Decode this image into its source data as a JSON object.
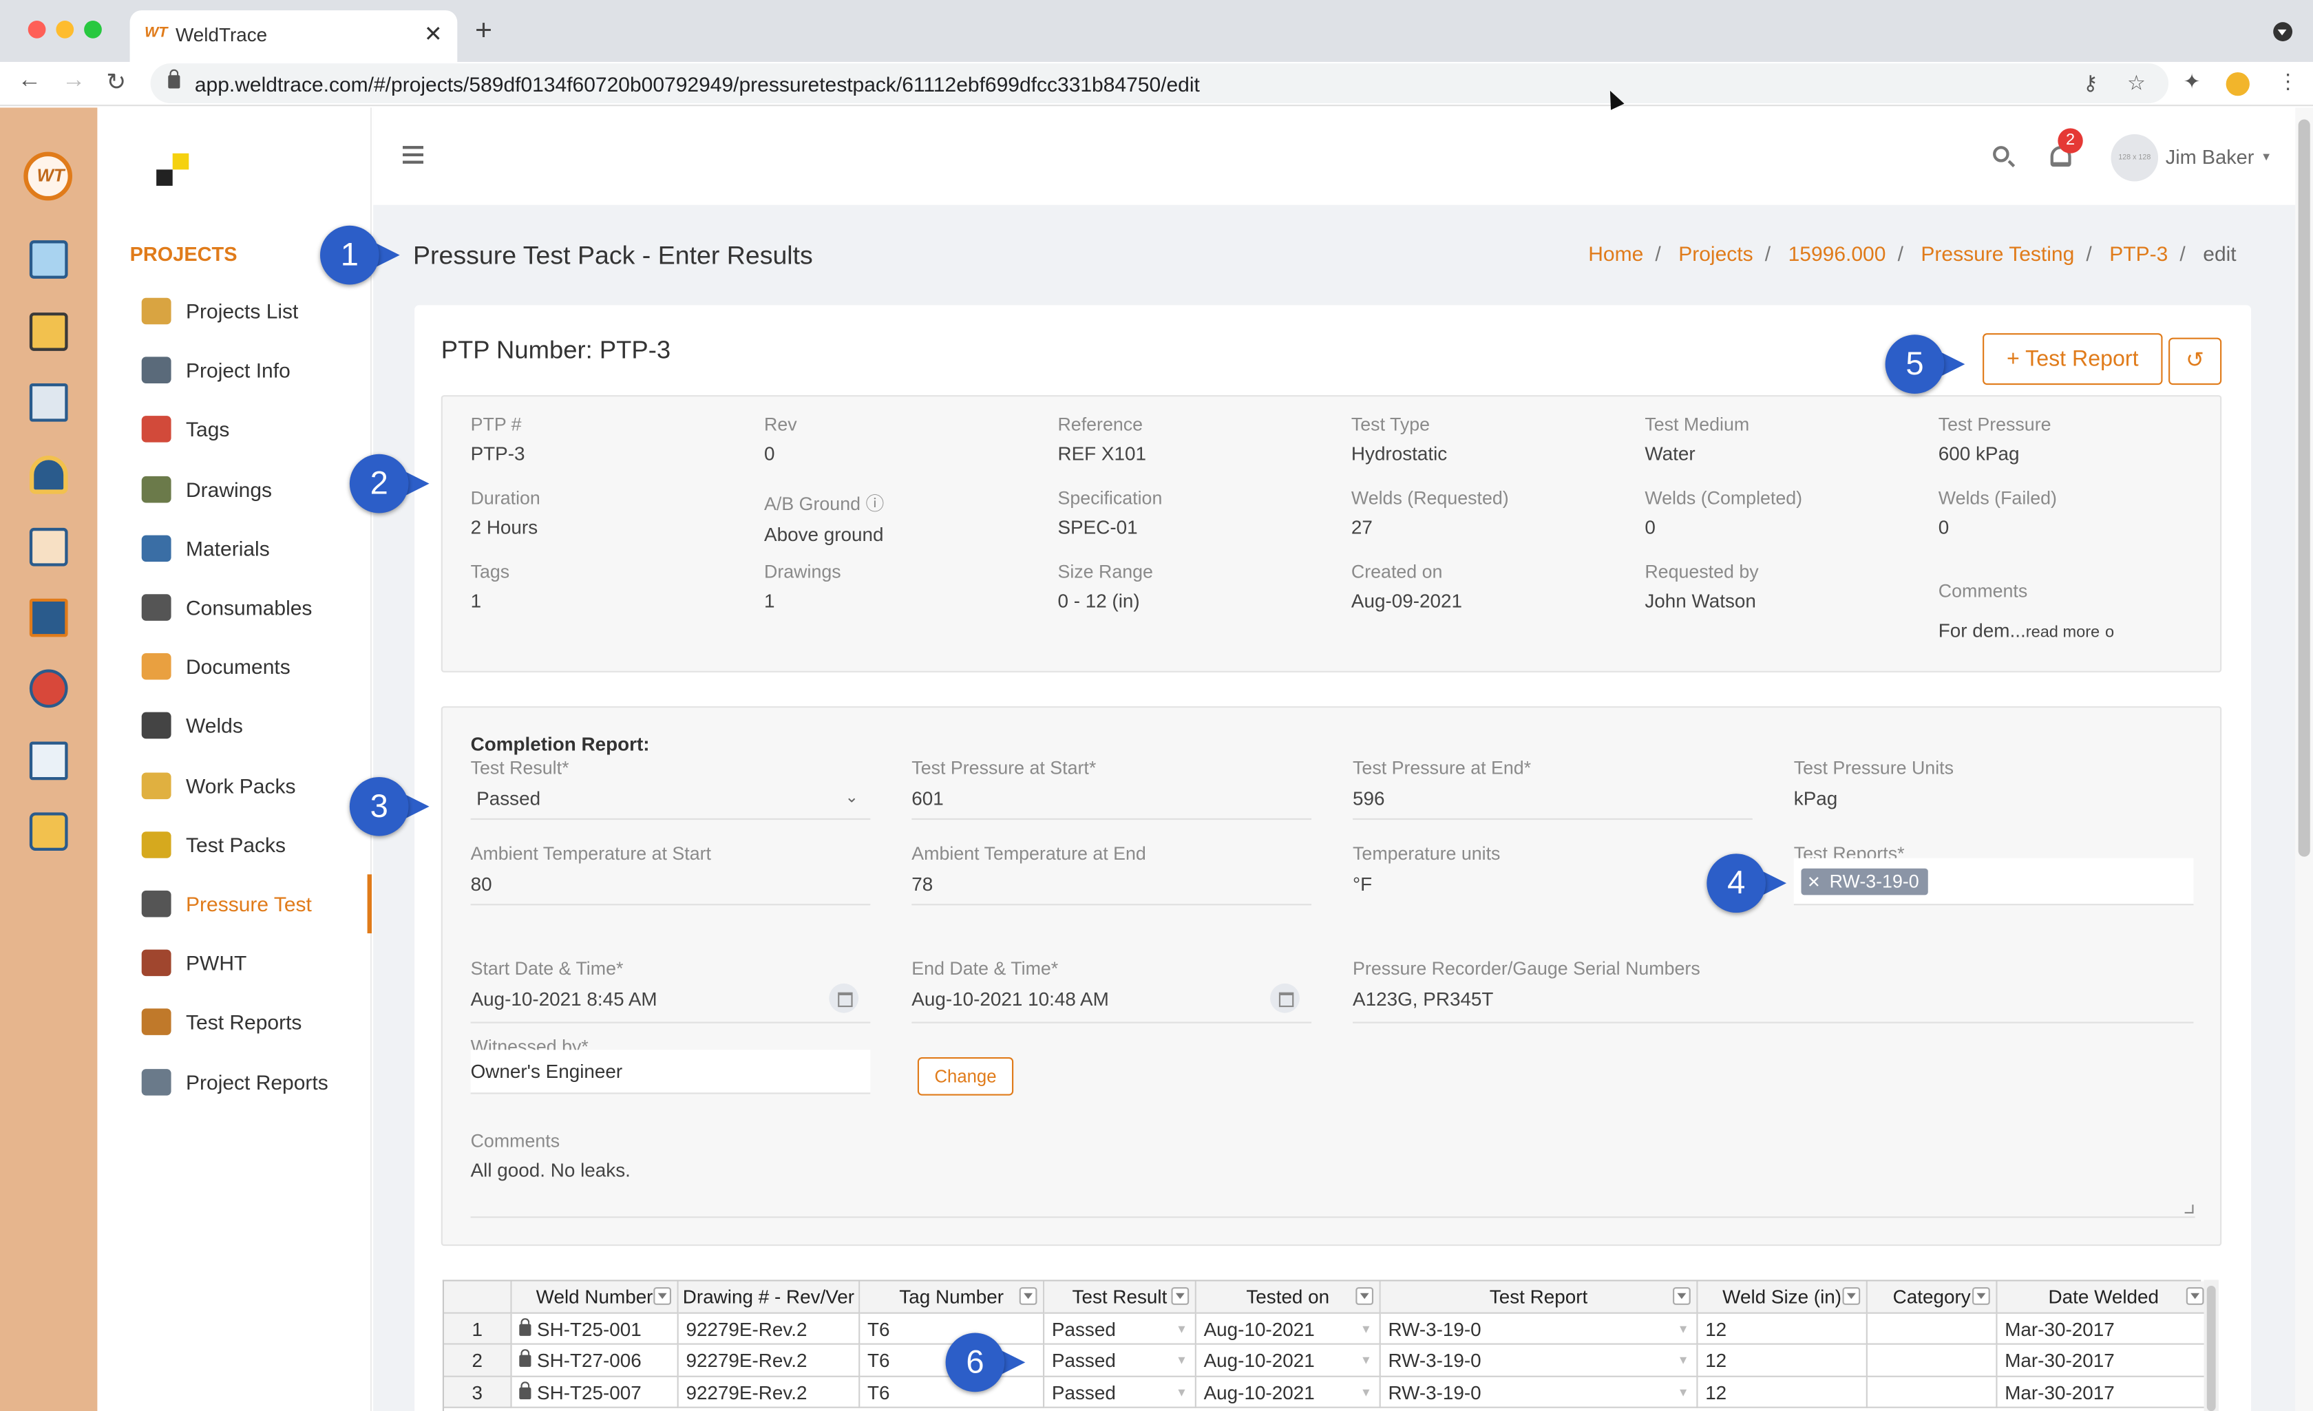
{
  "browser": {
    "tab_title": "WeldTrace",
    "tab_favicon": "WT",
    "url": "app.weldtrace.com/#/projects/589df0134f60720b00792949/pressuretestpack/61112ebf699dfcc331b84750/edit"
  },
  "rail": {
    "logo": "WT",
    "icons": [
      "monitor-icon",
      "folder-settings-icon",
      "clipboard-icon",
      "welder-icon",
      "org-chart-icon",
      "board-icon",
      "team-icon",
      "report-icon",
      "gauge-icon"
    ]
  },
  "sidebar": {
    "heading": "PROJECTS",
    "items": [
      {
        "label": "Projects List",
        "icon": "folder-icon",
        "color": "#d9a441"
      },
      {
        "label": "Project Info",
        "icon": "gears-icon",
        "color": "#5a6a7a"
      },
      {
        "label": "Tags",
        "icon": "tag-icon",
        "color": "#d24a3a"
      },
      {
        "label": "Drawings",
        "icon": "drawing-icon",
        "color": "#6b7a4a"
      },
      {
        "label": "Materials",
        "icon": "materials-icon",
        "color": "#3a6ea5"
      },
      {
        "label": "Consumables",
        "icon": "spool-icon",
        "color": "#555555"
      },
      {
        "label": "Documents",
        "icon": "documents-icon",
        "color": "#e9a040"
      },
      {
        "label": "Welds",
        "icon": "weld-spark-icon",
        "color": "#444444"
      },
      {
        "label": "Work Packs",
        "icon": "work-pack-icon",
        "color": "#e0b040"
      },
      {
        "label": "Test Packs",
        "icon": "radiation-icon",
        "color": "#d6a91e"
      },
      {
        "label": "Pressure Test",
        "icon": "pressure-gauge-icon",
        "color": "#555555",
        "active": true
      },
      {
        "label": "PWHT",
        "icon": "pwht-coil-icon",
        "color": "#a0462e"
      },
      {
        "label": "Test Reports",
        "icon": "test-report-icon",
        "color": "#c0792a"
      },
      {
        "label": "Project Reports",
        "icon": "project-report-icon",
        "color": "#6a7a8a"
      }
    ]
  },
  "topbar": {
    "notifications": "2",
    "avatar_text": "128 x 128",
    "user_name": "Jim Baker"
  },
  "page": {
    "title": "Pressure Test Pack - Enter Results",
    "breadcrumbs": [
      "Home",
      "Projects",
      "15996.000",
      "Pressure Testing",
      "PTP-3"
    ],
    "breadcrumb_last": "edit"
  },
  "card": {
    "ptp_number": "PTP Number: PTP-3",
    "test_report_button": "Test Report",
    "history_icon": "history-icon"
  },
  "info": {
    "ptp": {
      "label": "PTP #",
      "value": "PTP-3"
    },
    "rev": {
      "label": "Rev",
      "value": "0"
    },
    "reference": {
      "label": "Reference",
      "value": "REF X101"
    },
    "test_type": {
      "label": "Test Type",
      "value": "Hydrostatic"
    },
    "test_medium": {
      "label": "Test Medium",
      "value": "Water"
    },
    "test_pressure": {
      "label": "Test Pressure",
      "value": "600 kPag"
    },
    "duration": {
      "label": "Duration",
      "value": "2 Hours"
    },
    "ab_ground": {
      "label": "A/B Ground",
      "value": "Above ground"
    },
    "specification": {
      "label": "Specification",
      "value": "SPEC-01"
    },
    "welds_requested": {
      "label": "Welds (Requested)",
      "value": "27"
    },
    "welds_completed": {
      "label": "Welds (Completed)",
      "value": "0"
    },
    "welds_failed": {
      "label": "Welds (Failed)",
      "value": "0"
    },
    "tags": {
      "label": "Tags",
      "value": "1"
    },
    "drawings": {
      "label": "Drawings",
      "value": "1"
    },
    "size_range": {
      "label": "Size Range",
      "value": "0 - 12 (in)"
    },
    "created_on": {
      "label": "Created on",
      "value": "Aug-09-2021"
    },
    "requested_by": {
      "label": "Requested by",
      "value": "John Watson"
    },
    "comments": {
      "label": "Comments",
      "value": "For dem...",
      "read_more": "read more"
    }
  },
  "completion": {
    "title": "Completion Report:",
    "test_result": {
      "label": "Test Result*",
      "value": "Passed"
    },
    "pressure_start": {
      "label": "Test Pressure at Start*",
      "value": "601"
    },
    "pressure_end": {
      "label": "Test Pressure at End*",
      "value": "596"
    },
    "pressure_units": {
      "label": "Test Pressure Units",
      "value": "kPag"
    },
    "ambient_start": {
      "label": "Ambient Temperature at Start",
      "value": "80"
    },
    "ambient_end": {
      "label": "Ambient Temperature at End",
      "value": "78"
    },
    "temp_units": {
      "label": "Temperature units",
      "value": "°F"
    },
    "test_reports": {
      "label": "Test Reports*",
      "chip": "RW-3-19-0"
    },
    "start_dt": {
      "label": "Start Date & Time*",
      "value": "Aug-10-2021 8:45 AM"
    },
    "end_dt": {
      "label": "End Date & Time*",
      "value": "Aug-10-2021 10:48 AM"
    },
    "gauge_serials": {
      "label": "Pressure Recorder/Gauge Serial Numbers",
      "value": "A123G, PR345T"
    },
    "witnessed": {
      "label": "Witnessed by*",
      "value": "Owner's Engineer"
    },
    "change_button": "Change",
    "comments": {
      "label": "Comments",
      "value": "All good. No leaks."
    }
  },
  "grid": {
    "columns": [
      "",
      "Weld Number",
      "Drawing # - Rev/Ver",
      "Tag Number",
      "Test Result",
      "Tested on",
      "Test Report",
      "Weld Size (in)",
      "Category",
      "Date Welded"
    ],
    "rows": [
      [
        "1",
        "SH-T25-001",
        "92279E-Rev.2",
        "T6",
        "Passed",
        "Aug-10-2021",
        "RW-3-19-0",
        "12",
        "",
        "Mar-30-2017"
      ],
      [
        "2",
        "SH-T27-006",
        "92279E-Rev.2",
        "T6",
        "Passed",
        "Aug-10-2021",
        "RW-3-19-0",
        "12",
        "",
        "Mar-30-2017"
      ],
      [
        "3",
        "SH-T25-007",
        "92279E-Rev.2",
        "T6",
        "Passed",
        "Aug-10-2021",
        "RW-3-19-0",
        "12",
        "",
        "Mar-30-2017"
      ]
    ]
  },
  "callouts": [
    "1",
    "2",
    "3",
    "4",
    "5",
    "6"
  ],
  "colors": {
    "accent": "#e07b1a",
    "callout": "#2c5ec8",
    "rail": "#e6b58d"
  }
}
